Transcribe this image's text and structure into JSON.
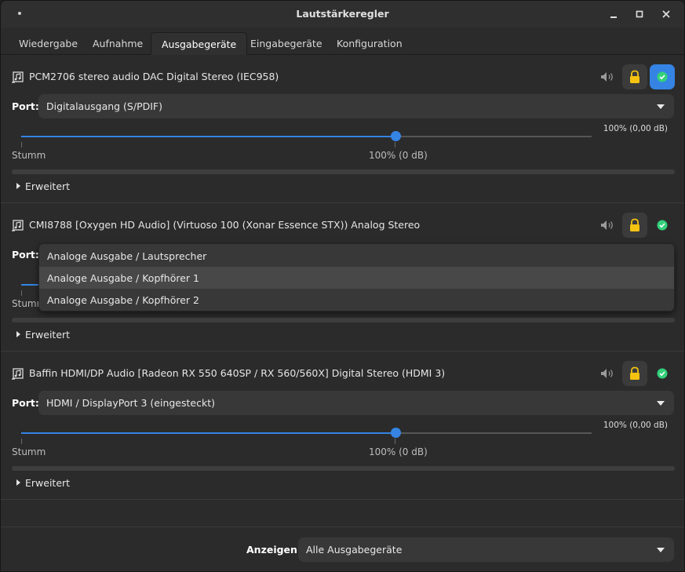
{
  "window": {
    "title": "Lautstärkeregler",
    "controls": [
      "minimize-icon",
      "maximize-icon",
      "close-icon"
    ]
  },
  "tabs": [
    {
      "label": "Wiedergabe",
      "active": false
    },
    {
      "label": "Aufnahme",
      "active": false
    },
    {
      "label": "Ausgabegeräte",
      "active": true
    },
    {
      "label": "Eingabegeräte",
      "active": false
    },
    {
      "label": "Konfiguration",
      "active": false
    }
  ],
  "devices": [
    {
      "name": "PCM2706 stereo audio DAC Digital Stereo (IEC958)",
      "port_label": "Port:",
      "port_value": "Digitalausgang (S/PDIF)",
      "volume_readout": "100% (0,00 dB)",
      "volume_percent": 100,
      "mute_label": "Stumm",
      "default_label": "100% (0 dB)",
      "expander_label": "Erweitert",
      "is_default": true
    },
    {
      "name": "CMI8788 [Oxygen HD Audio] (Virtuoso 100 (Xonar Essence STX)) Analog Stereo",
      "port_label": "Port:",
      "mute_label": "Stumm",
      "expander_label": "Erweitert",
      "is_default": false,
      "port_options": [
        "Analoge Ausgabe / Lautsprecher",
        "Analoge Ausgabe / Kopfhörer 1",
        "Analoge Ausgabe / Kopfhörer 2"
      ],
      "highlighted_option": 1
    },
    {
      "name": "Baffin HDMI/DP Audio [Radeon RX 550 640SP / RX 560/560X] Digital Stereo (HDMI 3)",
      "port_label": "Port:",
      "port_value": "HDMI / DisplayPort 3 (eingesteckt)",
      "volume_readout": "100% (0,00 dB)",
      "volume_percent": 100,
      "mute_label": "Stumm",
      "default_label": "100% (0 dB)",
      "expander_label": "Erweitert",
      "is_default": false
    }
  ],
  "footer": {
    "label": "Anzeigen:",
    "value": "Alle Ausgabegeräte"
  },
  "colors": {
    "accent": "#3584e4",
    "lock": "#f5c211",
    "check_green": "#33d17a"
  }
}
